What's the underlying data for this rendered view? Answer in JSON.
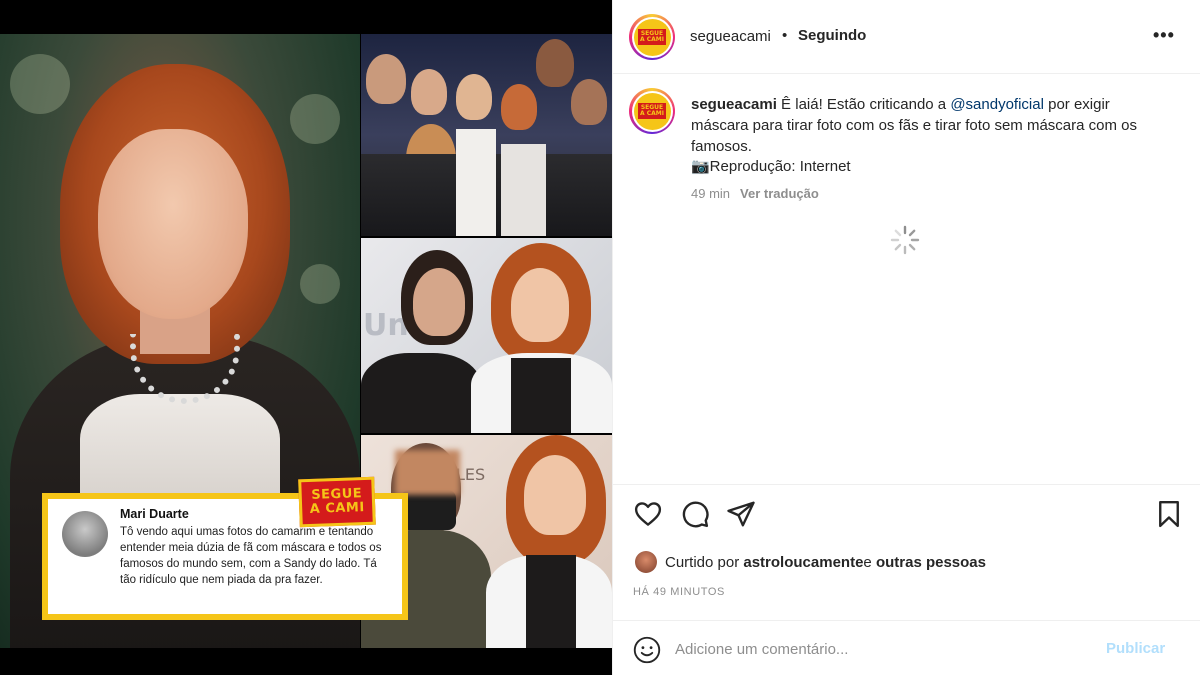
{
  "post": {
    "username": "segueacami",
    "separator": "•",
    "follow_status": "Seguindo",
    "more_label": "•••",
    "caption_before_mention": " Ê laiá! Estão criticando a ",
    "mention": "@sandyoficial",
    "caption_after_mention": " por exigir máscara para tirar foto com os fãs e tirar foto sem máscara com os famosos.",
    "caption_credit": "📷Reprodução: Internet",
    "age": "49 min",
    "translate_label": "Ver tradução",
    "liked_prefix": "Curtido por ",
    "liked_user": "astroloucamente",
    "liked_middle": " e ",
    "liked_others": "outras pessoas",
    "timestamp_caps": "HÁ 49 MINUTOS",
    "comment_placeholder": "Adicione um comentário...",
    "publish_label": "Publicar"
  },
  "media": {
    "brand_line1": "SEGUE",
    "brand_line2": "A CAMI",
    "comment_author": "Mari Duarte",
    "comment_text": "Tô vendo aqui umas fotos do camarim e tentando entender meia dúzia de fã com máscara e todos os famosos do mundo sem, com a Sandy do lado. Tá tão ridículo que nem piada da pra fazer.",
    "backdrop_text_1": "Uni",
    "backdrop_text_2": "LES"
  },
  "icons": {
    "like": "heart-icon",
    "comment": "comment-icon",
    "share": "paper-plane-icon",
    "save": "bookmark-icon",
    "emoji": "emoji-icon",
    "more": "more-options-icon",
    "loading": "spinner-icon"
  },
  "colors": {
    "brand_red": "#d41b1b",
    "brand_yellow": "#f5c518",
    "mention_blue": "#00376b",
    "publish_disabled": "#b2dffc",
    "muted_text": "#8e8e8e"
  }
}
